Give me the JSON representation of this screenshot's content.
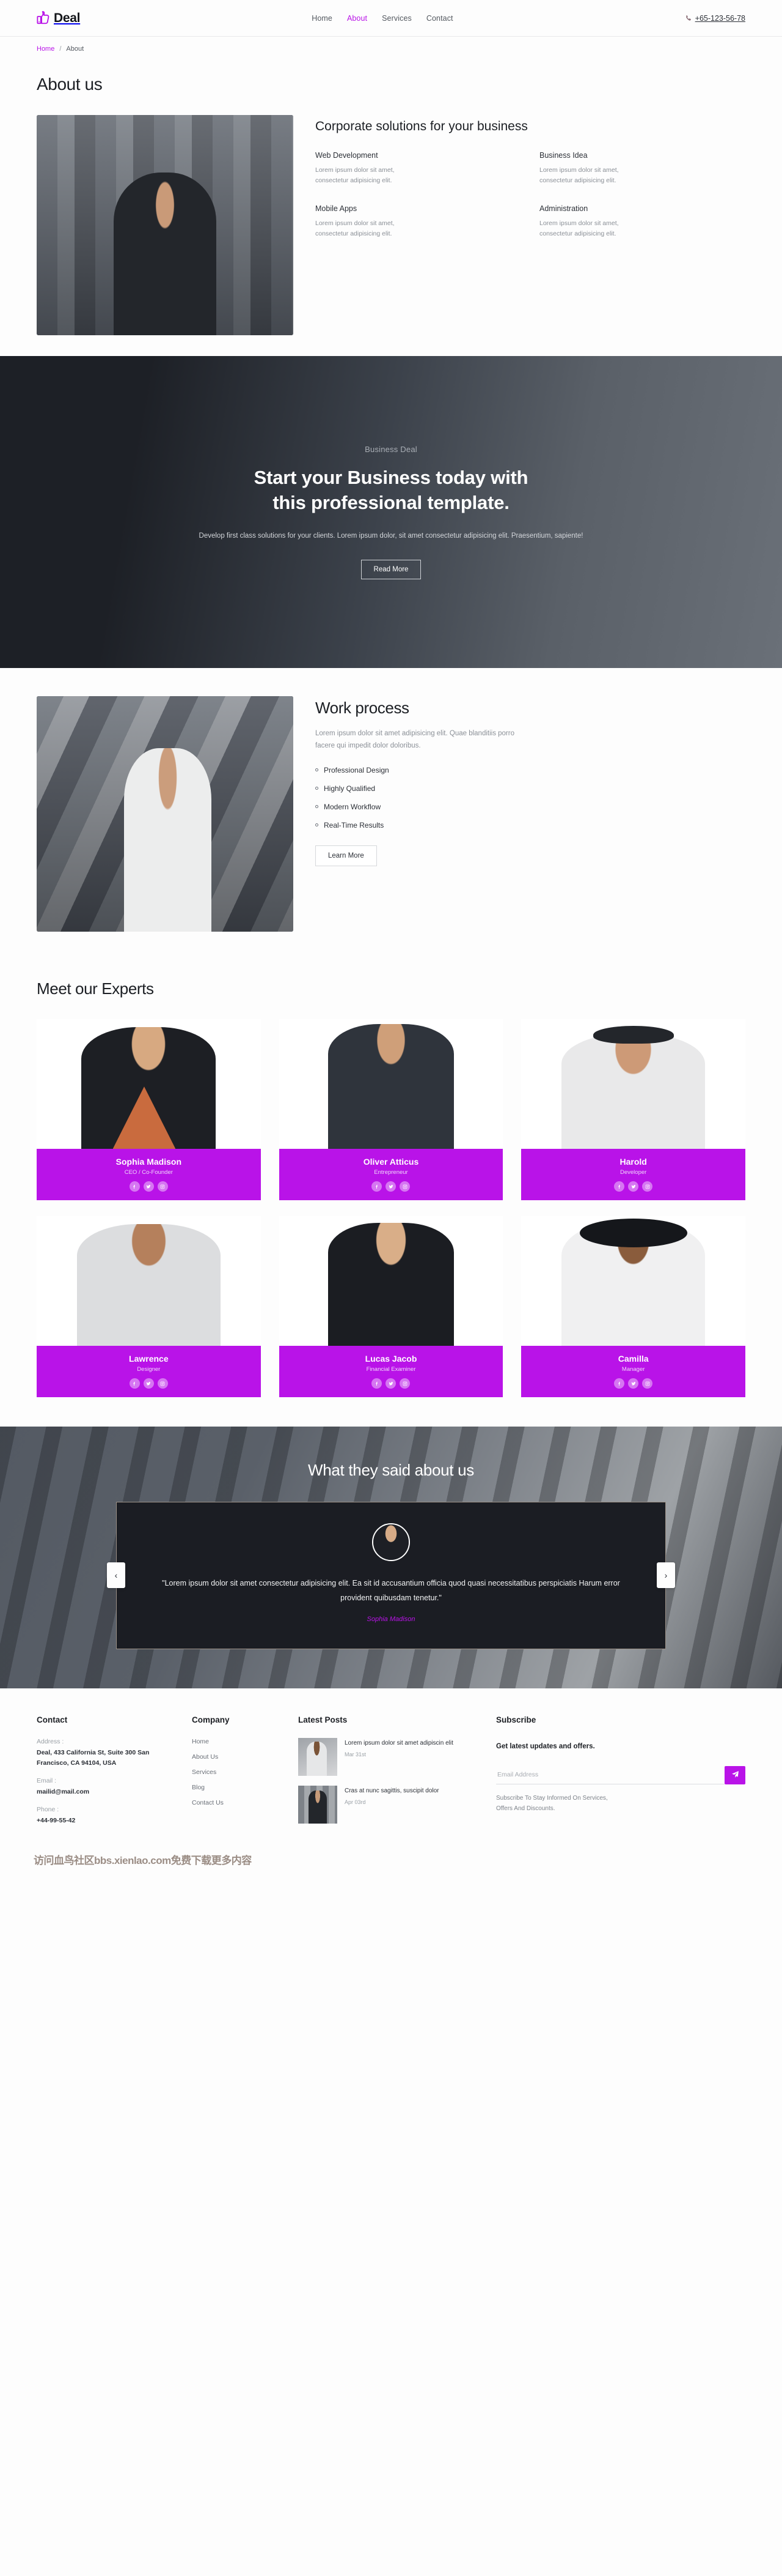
{
  "navbar": {
    "brand": "Deal",
    "brand_icon": "thumbs-up-icon",
    "links": [
      {
        "label": "Home",
        "active": false
      },
      {
        "label": "About",
        "active": true
      },
      {
        "label": "Services",
        "active": false
      },
      {
        "label": "Contact",
        "active": false
      }
    ],
    "phone": "+65-123-56-78",
    "phone_icon": "phone-icon"
  },
  "breadcrumb": {
    "home": "Home",
    "separator": "/",
    "current": "About"
  },
  "about": {
    "page_title": "About us",
    "heading": "Corporate solutions for your business",
    "features": [
      {
        "title": "Web Development",
        "text": "Lorem ipsum dolor sit amet, consectetur adipisicing elit."
      },
      {
        "title": "Business Idea",
        "text": "Lorem ipsum dolor sit amet, consectetur adipisicing elit."
      },
      {
        "title": "Mobile Apps",
        "text": "Lorem ipsum dolor sit amet, consectetur adipisicing elit."
      },
      {
        "title": "Administration",
        "text": "Lorem ipsum dolor sit amet, consectetur adipisicing elit."
      }
    ]
  },
  "hero": {
    "kicker": "Business Deal",
    "title_line1": "Start your Business today with",
    "title_line2": "this professional template.",
    "text": "Develop first class solutions for your clients. Lorem ipsum dolor, sit amet consectetur adipisicing elit. Praesentium, sapiente!",
    "button": "Read More"
  },
  "work": {
    "title": "Work process",
    "text": "Lorem ipsum dolor sit amet adipisicing elit. Quae blanditiis porro facere qui impedit dolor doloribus.",
    "items": [
      "Professional Design",
      "Highly Qualified",
      "Modern Workflow",
      "Real-Time Results"
    ],
    "button": "Learn More"
  },
  "experts": {
    "title": "Meet our Experts",
    "social_icons": [
      "facebook-icon",
      "twitter-icon",
      "instagram-icon"
    ],
    "members": [
      {
        "name": "Sophia Madison",
        "role": "CEO / Co-Founder"
      },
      {
        "name": "Oliver Atticus",
        "role": "Entrepreneur"
      },
      {
        "name": "Harold",
        "role": "Developer"
      },
      {
        "name": "Lawrence",
        "role": "Designer"
      },
      {
        "name": "Lucas Jacob",
        "role": "Financial Examiner"
      },
      {
        "name": "Camilla",
        "role": "Manager"
      }
    ]
  },
  "testimonials": {
    "title": "What they said about us",
    "prev_label": "‹",
    "next_label": "›",
    "quote": "\"Lorem ipsum dolor sit amet consectetur adipisicing elit. Ea sit id accusantium officia quod quasi necessitatibus perspiciatis Harum error provident quibusdam tenetur.\"",
    "author": "Sophia Madison"
  },
  "footer": {
    "contact": {
      "heading": "Contact",
      "address_label": "Address :",
      "address_value": "Deal, 433 California St, Suite 300 San Francisco, CA 94104, USA",
      "email_label": "Email :",
      "email_value": "mailid@mail.com",
      "phone_label": "Phone :",
      "phone_value": "+44-99-55-42"
    },
    "company": {
      "heading": "Company",
      "links": [
        "Home",
        "About Us",
        "Services",
        "Blog",
        "Contact Us"
      ]
    },
    "posts": {
      "heading": "Latest Posts",
      "items": [
        {
          "title": "Lorem ipsum dolor sit amet adipiscin elit",
          "date": "Mar 31st"
        },
        {
          "title": "Cras at nunc sagittis, suscipit dolor",
          "date": "Apr 03rd"
        }
      ]
    },
    "subscribe": {
      "heading": "Subscribe",
      "tagline": "Get latest updates and offers.",
      "placeholder": "Email Address",
      "input_value": "",
      "submit_icon": "paper-plane-icon",
      "note": "Subscribe To Stay Informed On Services, Offers And Discounts."
    }
  },
  "watermark": "访问血鸟社区bbs.xienlao.com免费下载更多内容",
  "colors": {
    "accent": "#b913e8",
    "dark": "#1d2026",
    "text": "#2b2f36",
    "muted": "#8b9097"
  }
}
